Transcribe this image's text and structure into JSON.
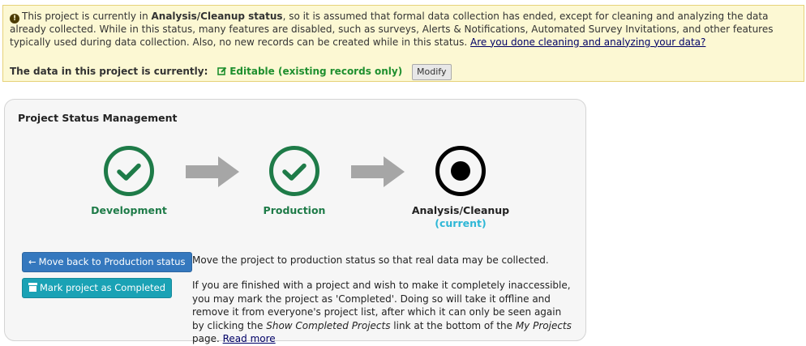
{
  "notice": {
    "icon": "exclamation-circle-icon",
    "text_prefix": "This project is currently in ",
    "status_bold": "Analysis/Cleanup status",
    "text_body": ", so it is assumed that formal data collection has ended, except for cleaning and analyzing the data already collected. While in this status, many features are disabled, such as surveys, Alerts & Notifications, Automated Survey Invitations, and other features typically used during data collection. Also, no new records can be created while in this status. ",
    "link": "Are you done cleaning and analyzing your data?",
    "current_label": "The data in this project is currently:",
    "current_value": "Editable (existing records only)",
    "current_icon": "edit-icon",
    "modify_button": "Modify"
  },
  "panel": {
    "title": "Project Status Management",
    "stages": [
      {
        "name": "Development",
        "state": "done",
        "icon": "check-circle-icon"
      },
      {
        "name": "Production",
        "state": "done",
        "icon": "check-circle-icon"
      },
      {
        "name": "Analysis/Cleanup",
        "state": "current",
        "icon": "radio-dot-icon",
        "tag": "(current)"
      }
    ],
    "back_button": "Move back to Production status",
    "back_description": "Move the project to production status so that real data may be collected.",
    "complete_button": "Mark project as Completed",
    "complete_description_1": "If you are finished with a project and wish to make it completely inaccessible, you may mark the project as 'Completed'. Doing so will take it offline and remove it from everyone's project list, after which it can only be seen again by clicking the ",
    "complete_description_italic_1": "Show Completed Projects",
    "complete_description_2": " link at the bottom of the ",
    "complete_description_italic_2": "My Projects",
    "complete_description_3": " page. ",
    "read_more": "Read more"
  },
  "colors": {
    "notice_bg": "#fcf8d3",
    "done_green": "#1e7b48",
    "editable_green": "#1e8f2e",
    "current_cyan": "#2eb7d6",
    "back_button_blue": "#3578be",
    "complete_button_teal": "#1aa2b5"
  }
}
